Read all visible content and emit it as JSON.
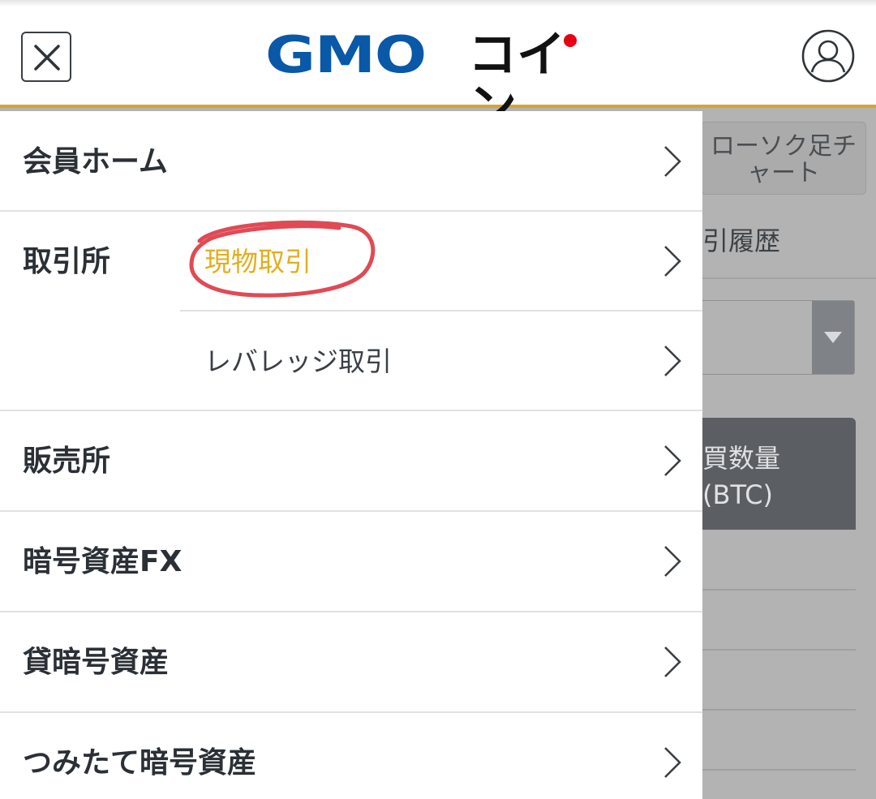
{
  "header": {
    "logo_gmo": "GMO",
    "logo_coin": "コイン",
    "accent_color": "#d9a32e",
    "logo_blue": "#0a58a8",
    "logo_red": "#e60012",
    "icons": [
      "close-icon",
      "user-icon"
    ]
  },
  "menu": {
    "items": [
      {
        "label": "会員ホーム"
      },
      {
        "label": "取引所",
        "sub": [
          "現物取引",
          "レバレッジ取引"
        ]
      },
      {
        "label": "販売所"
      },
      {
        "label": "暗号資産FX"
      },
      {
        "label": "貸暗号資産"
      },
      {
        "label": "つみたて暗号資産"
      }
    ],
    "highlight_color": "#e3ad1f",
    "annotation_color": "#e04a55"
  },
  "background": {
    "tab_label": "ローソク足チャート",
    "tab_line1": "ローソク足チ",
    "tab_line2": "ャート",
    "history_label": "引履歴",
    "column_header_line1": "買数量",
    "column_header_line2": "(BTC)"
  }
}
